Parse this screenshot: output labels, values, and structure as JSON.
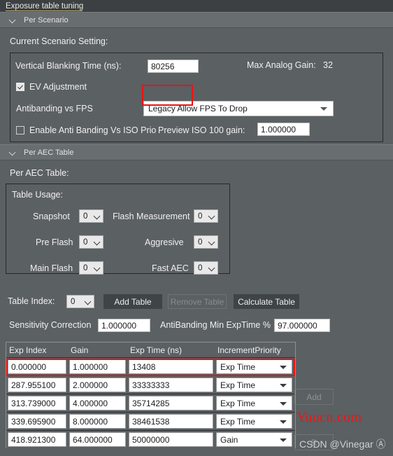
{
  "window": {
    "title": "Exposure table tuning"
  },
  "sections": {
    "per_scenario": {
      "label": "Per Scenario",
      "chevron_icon": "chevron-down-icon"
    },
    "per_aec_table": {
      "label": "Per AEC Table",
      "chevron_icon": "chevron-down-icon"
    }
  },
  "scenario": {
    "lead": "Current Scenario Setting:",
    "vertical_blanking_label": "Vertical Blanking Time (ns):",
    "vertical_blanking_value": "80256",
    "max_analog_gain_label": "Max Analog Gain:",
    "max_analog_gain_value": "32",
    "ev_adjustment_label": "EV Adjustment",
    "ev_adjustment_checked": true,
    "antibanding_vs_fps_label": "Antibanding vs FPS",
    "antibanding_vs_fps_value": "Legacy Allow FPS To Drop",
    "enable_anti_banding_label": "Enable Anti Banding Vs ISO Prio",
    "enable_anti_banding_checked": false,
    "preview_iso_label": "Preview ISO 100 gain:",
    "preview_iso_value": "1.000000"
  },
  "aec": {
    "lead": "Per AEC Table:",
    "table_usage_label": "Table Usage:",
    "usage": [
      {
        "label": "Snapshot",
        "value": "0"
      },
      {
        "label": "Flash Measurement",
        "value": "0"
      },
      {
        "label": "Pre Flash",
        "value": "0"
      },
      {
        "label": "Aggresive",
        "value": "0"
      },
      {
        "label": "Main Flash",
        "value": "0"
      },
      {
        "label": "Fast AEC",
        "value": "0"
      }
    ],
    "table_index_label": "Table Index:",
    "table_index_value": "0",
    "add_table_label": "Add Table",
    "remove_table_label": "Remove Table",
    "calculate_table_label": "Calculate Table",
    "sensitivity_correction_label": "Sensitivity Correction",
    "sensitivity_correction_value": "1.000000",
    "antibanding_min_exptime_label": "AntiBanding Min ExpTime %",
    "antibanding_min_exptime_value": "97.000000"
  },
  "grid": {
    "columns": [
      "Exp Index",
      "Gain",
      "Exp Time (ns)",
      "IncrementPriority"
    ],
    "rows": [
      {
        "exp_index": "0.000000",
        "gain": "1.000000",
        "exp_time": "13408",
        "priority": "Exp Time"
      },
      {
        "exp_index": "287.955100",
        "gain": "2.000000",
        "exp_time": "33333333",
        "priority": "Exp Time"
      },
      {
        "exp_index": "313.739000",
        "gain": "4.000000",
        "exp_time": "35714285",
        "priority": "Exp Time"
      },
      {
        "exp_index": "339.695900",
        "gain": "8.000000",
        "exp_time": "38461538",
        "priority": "Exp Time"
      },
      {
        "exp_index": "418.921300",
        "gain": "64.000000",
        "exp_time": "50000000",
        "priority": "Gain"
      }
    ]
  },
  "side_actions": {
    "add_label": "Add",
    "remove_label": "R"
  },
  "watermarks": {
    "red": "Yuucn.com",
    "grey": "CSDN @Vinegar Ⓐ"
  },
  "colors": {
    "window_bg": "#5b6063",
    "titlebar_bg": "#3c4042",
    "section_header_bg": "#686d70",
    "highlight_red": "#ee1111",
    "button_bg": "#3f4447",
    "input_bg": "#ffffff"
  }
}
